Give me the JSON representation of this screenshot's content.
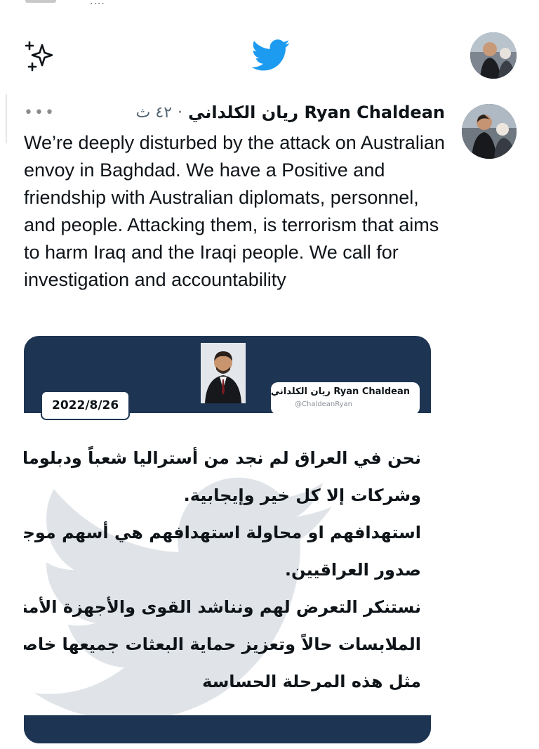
{
  "topbar": {
    "sparkle_icon": "sparkle-icon",
    "logo_icon": "twitter-bird-icon",
    "brand_color": "#1d9bf0"
  },
  "tweet": {
    "author_name": "ريان الكلداني Ryan Chaldean",
    "separator": "·",
    "timestamp": "٤٢ ث",
    "more_icon": "more-dots-icon",
    "more_label": "•••",
    "text": "We’re deeply disturbed by the attack on Australian envoy in Baghdad. We have a Positive and friendship with Australian diplomats, personnel, and people. Attacking them, is terrorism that aims to harm Iraq and the Iraqi people. We call for investigation and accountability"
  },
  "card": {
    "date": "2022/8/26",
    "name": "ريان الكلداني Ryan Chaldean",
    "handle": "@ChaldeanRyan",
    "lines": [
      "نحن في العراق لم نجد من أستراليا شعباً ودبلوماسيةً وبعثات",
      "وشركات إلا كل خير وإيجابية.",
      "استهدافهم او محاولة استهدافهم هي أسهم موجهة الى",
      "صدور العراقيين.",
      "نستنكر التعرض لهم ونناشد القوى والأجهزة الأمنية لكشف",
      "الملابسات حالاً وتعزيز حماية البعثات جميعها خاصة في",
      "مثل هذه المرحلة الحساسة"
    ],
    "accent_color": "#1d3552"
  }
}
